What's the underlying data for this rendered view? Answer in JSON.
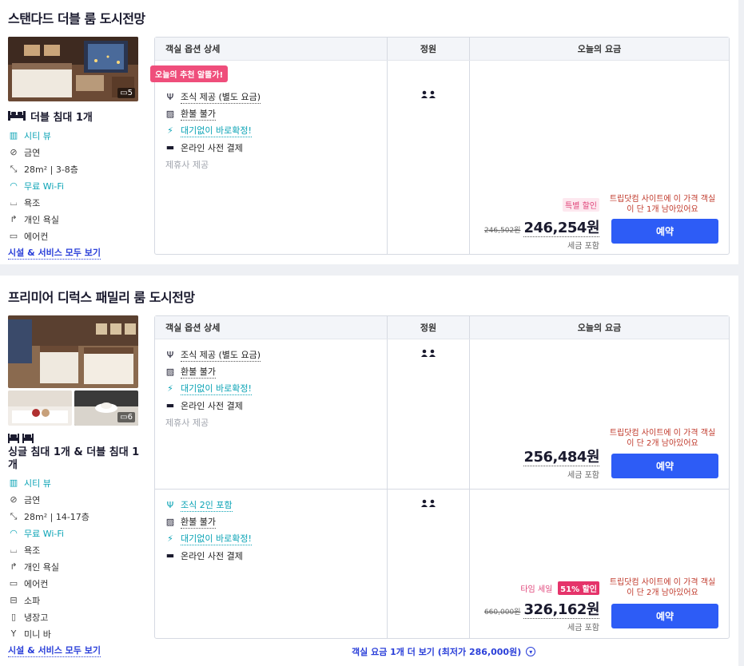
{
  "colors": {
    "accent": "#2d5cf6",
    "teal": "#0aa3b5",
    "pink": "#ef4e7b",
    "warn": "#c0392b"
  },
  "table_headers": {
    "options": "객실 옵션 상세",
    "capacity": "정원",
    "price": "오늘의 요금"
  },
  "rooms": [
    {
      "title": "스탠다드 더블 룸 도시전망",
      "photo_count": "5",
      "bed": "더블 침대 1개",
      "amenities": [
        {
          "icon": "window-icon",
          "label": "시티 뷰",
          "highlight": true
        },
        {
          "icon": "no-smoking-icon",
          "label": "금연",
          "highlight": false
        },
        {
          "icon": "size-icon",
          "label": "28m² | 3-8층",
          "highlight": false
        },
        {
          "icon": "wifi-icon",
          "label": "무료 Wi-Fi",
          "highlight": true
        },
        {
          "icon": "bathtub-icon",
          "label": "욕조",
          "highlight": false
        },
        {
          "icon": "shower-icon",
          "label": "개인 욕실",
          "highlight": false
        },
        {
          "icon": "aircon-icon",
          "label": "에어컨",
          "highlight": false
        }
      ],
      "see_all": "시설 & 서비스 모두 보기",
      "rates": [
        {
          "recommend_badge": "오늘의 추천 알뜰가!",
          "options": [
            {
              "icon": "utensils-icon",
              "label": "조식 제공 (별도 요금)",
              "style": "u"
            },
            {
              "icon": "no-refund-icon",
              "label": "환불 불가",
              "style": "u"
            },
            {
              "icon": "bolt-icon",
              "label": "대기없이 바로확정!",
              "style": "teal"
            },
            {
              "icon": "card-icon",
              "label": "온라인 사전 결제",
              "style": ""
            },
            {
              "icon": "",
              "label": "제휴사 제공",
              "style": "gray"
            }
          ],
          "guests": "👤👤",
          "badges": [
            {
              "text": "특별 할인",
              "kind": "pink"
            }
          ],
          "original_price": "246,502원",
          "price": "246,254원",
          "tax": "세금 포함",
          "warning": "트립닷컴 사이트에 이 가격 객실이 단 1개 남아있어요",
          "book": "예약"
        }
      ]
    },
    {
      "title": "프리미어 디럭스 패밀리 룸 도시전망",
      "photo_count": "6",
      "bed": "싱글 침대 1개 & 더블 침대 1개",
      "amenities": [
        {
          "icon": "window-icon",
          "label": "시티 뷰",
          "highlight": true
        },
        {
          "icon": "no-smoking-icon",
          "label": "금연",
          "highlight": false
        },
        {
          "icon": "size-icon",
          "label": "28m² | 14-17층",
          "highlight": false
        },
        {
          "icon": "wifi-icon",
          "label": "무료 Wi-Fi",
          "highlight": true
        },
        {
          "icon": "bathtub-icon",
          "label": "욕조",
          "highlight": false
        },
        {
          "icon": "shower-icon",
          "label": "개인 욕실",
          "highlight": false
        },
        {
          "icon": "aircon-icon",
          "label": "에어컨",
          "highlight": false
        },
        {
          "icon": "sofa-icon",
          "label": "소파",
          "highlight": false
        },
        {
          "icon": "fridge-icon",
          "label": "냉장고",
          "highlight": false
        },
        {
          "icon": "minibar-icon",
          "label": "미니 바",
          "highlight": false
        }
      ],
      "see_all": "시설 & 서비스 모두 보기",
      "rates": [
        {
          "recommend_badge": "",
          "options": [
            {
              "icon": "utensils-icon",
              "label": "조식 제공 (별도 요금)",
              "style": "u"
            },
            {
              "icon": "no-refund-icon",
              "label": "환불 불가",
              "style": "u"
            },
            {
              "icon": "bolt-icon",
              "label": "대기없이 바로확정!",
              "style": "teal"
            },
            {
              "icon": "card-icon",
              "label": "온라인 사전 결제",
              "style": ""
            },
            {
              "icon": "",
              "label": "제휴사 제공",
              "style": "gray"
            }
          ],
          "guests": "👤👤",
          "badges": [],
          "original_price": "",
          "price": "256,484원",
          "tax": "세금 포함",
          "warning": "트립닷컴 사이트에 이 가격 객실이 단 2개 남아있어요",
          "book": "예약"
        },
        {
          "recommend_badge": "",
          "options": [
            {
              "icon": "utensils-icon",
              "label": "조식 2인 포함",
              "style": "teal"
            },
            {
              "icon": "no-refund-icon",
              "label": "환불 불가",
              "style": "u"
            },
            {
              "icon": "bolt-icon",
              "label": "대기없이 바로확정!",
              "style": "teal"
            },
            {
              "icon": "card-icon",
              "label": "온라인 사전 결제",
              "style": ""
            }
          ],
          "guests": "👤👤",
          "badges": [
            {
              "text": "타임 세일",
              "kind": "time"
            },
            {
              "text": "51% 할인",
              "kind": "red"
            }
          ],
          "original_price": "660,000원",
          "price": "326,162원",
          "tax": "세금 포함",
          "warning": "트립닷컴 사이트에 이 가격 객실이 단 2개 남아있어요",
          "book": "예약"
        }
      ]
    }
  ],
  "more_rates": "객실 요금 1개 더 보기 (최저가 286,000원)"
}
